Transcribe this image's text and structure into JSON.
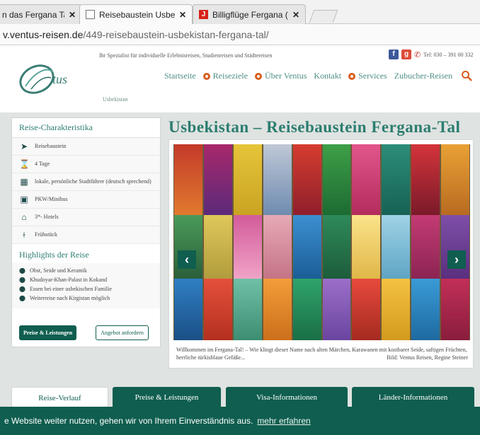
{
  "browser": {
    "tabs": [
      {
        "title": "n das Fergana Tal",
        "active": false,
        "icon": "none"
      },
      {
        "title": "Reisebaustein Usbekistan |",
        "active": true,
        "icon": "document-icon"
      },
      {
        "title": "Billigflüge Fergana (FEG) al",
        "active": false,
        "icon": "red-logo-icon"
      }
    ],
    "close_glyph": "✕",
    "url_host": "v.ventus-reisen.de",
    "url_path": "/449-reisebaustein-usbekistan-fergana-tal/"
  },
  "header": {
    "tagline": "Ihr Spezialist für individuelle Erlebnisreisen, Studienreisen und Städtereisen",
    "phone": "Tel: 030 – 391 00 332",
    "logo_text": "Ventus",
    "nav": [
      {
        "label": "Startseite",
        "dot": false
      },
      {
        "label": "Reiseziele",
        "dot": true
      },
      {
        "label": "Über Ventus",
        "dot": true
      },
      {
        "label": "Kontakt",
        "dot": false
      },
      {
        "label": "Services",
        "dot": true
      },
      {
        "label": "Zubucher-Reisen",
        "dot": false
      }
    ],
    "breadcrumb": "Usbekistan"
  },
  "sidebar": {
    "title": "Reise-Charakteristika",
    "items": [
      {
        "icon": "plane-arrow-icon",
        "glyph": "➤",
        "text": "Reisebaustein"
      },
      {
        "icon": "hourglass-icon",
        "glyph": "⌛",
        "text": "4 Tage"
      },
      {
        "icon": "map-icon",
        "glyph": "▦",
        "text": "lokale, persönliche Stadtführer (deutsch sprechend)"
      },
      {
        "icon": "car-icon",
        "glyph": "▣",
        "text": "PKW/Minibus"
      },
      {
        "icon": "house-icon",
        "glyph": "⌂",
        "text": "3*- Hotels"
      },
      {
        "icon": "cutlery-icon",
        "glyph": "ǂ",
        "text": "Frühstück"
      }
    ],
    "highlights_title": "Highlights der Reise",
    "highlights": [
      "Obst, Seide und Keramik",
      "Khudoyar-Khan-Palast in Kokand",
      "Essen bei einer usbekischen Familie",
      "Weiterreise nach Kirgistan möglich"
    ],
    "button_primary": "Preise & Leistungen",
    "button_secondary": "Angebot anfordern"
  },
  "main": {
    "title": "Usbekistan – Reisebaustein Fergana-Tal",
    "caption": "Willkommen im Fergana-Tal! – Wie klingt dieser Name nach alten Märchen, Karawanen mit kostbarer Seide, saftigen Früchten, herrliche türkisblaue Gefäße...",
    "credit": "Bild: Ventus Reisen, Regine Steiner"
  },
  "content_tabs": [
    {
      "label": "Reise-Verlauf",
      "active": true
    },
    {
      "label": "Preise & Leistungen",
      "active": false
    },
    {
      "label": "Visa-Informationen",
      "active": false
    },
    {
      "label": "Länder-Informationen",
      "active": false
    }
  ],
  "cookie": {
    "text": "e Website weiter nutzen, gehen wir von Ihrem Einverständnis aus.",
    "link": "mehr erfahren"
  },
  "colors": {
    "brand_green": "#0f5e4f",
    "accent_teal": "#2c7d70",
    "nav_dot": "#d85d1d"
  }
}
